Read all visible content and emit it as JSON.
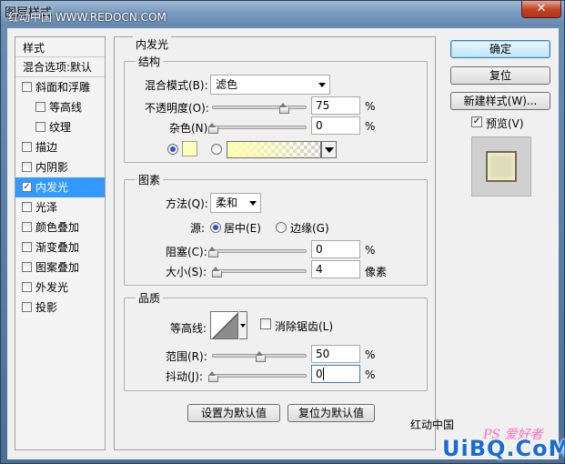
{
  "window": {
    "title": "图层样式",
    "watermark_top": "红动中国 WWW.REDOCN.COM",
    "close_label": "✕"
  },
  "style_list": {
    "header": "样式",
    "blend_options": "混合选项:默认",
    "items": [
      {
        "label": "斜面和浮雕",
        "checked": false,
        "indent": false,
        "active": false
      },
      {
        "label": "等高线",
        "checked": false,
        "indent": true,
        "active": false
      },
      {
        "label": "纹理",
        "checked": false,
        "indent": true,
        "active": false
      },
      {
        "label": "描边",
        "checked": false,
        "indent": false,
        "active": false
      },
      {
        "label": "内阴影",
        "checked": false,
        "indent": false,
        "active": false
      },
      {
        "label": "内发光",
        "checked": true,
        "indent": false,
        "active": true
      },
      {
        "label": "光泽",
        "checked": false,
        "indent": false,
        "active": false
      },
      {
        "label": "颜色叠加",
        "checked": false,
        "indent": false,
        "active": false
      },
      {
        "label": "渐变叠加",
        "checked": false,
        "indent": false,
        "active": false
      },
      {
        "label": "图案叠加",
        "checked": false,
        "indent": false,
        "active": false
      },
      {
        "label": "外发光",
        "checked": false,
        "indent": false,
        "active": false
      },
      {
        "label": "投影",
        "checked": false,
        "indent": false,
        "active": false
      }
    ]
  },
  "panel": {
    "title": "内发光",
    "structure": {
      "title": "结构",
      "blend_mode_label": "混合模式(B):",
      "blend_mode_value": "滤色",
      "opacity_label": "不透明度(O):",
      "opacity_value": "75",
      "opacity_level": 75,
      "opacity_unit": "%",
      "noise_label": "杂色(N):",
      "noise_value": "0",
      "noise_level": 0,
      "noise_unit": "%",
      "glow_color": "#ffffb9"
    },
    "elements": {
      "title": "图素",
      "technique_label": "方法(Q):",
      "technique_value": "柔和",
      "source_label": "源:",
      "source_center": "居中(E)",
      "source_edge": "边缘(G)",
      "choke_label": "阻塞(C):",
      "choke_value": "0",
      "choke_level": 0,
      "choke_unit": "%",
      "size_label": "大小(S):",
      "size_value": "4",
      "size_level": 4,
      "size_unit": "像素"
    },
    "quality": {
      "title": "品质",
      "contour_label": "等高线:",
      "antialias_label": "消除锯齿(L)",
      "range_label": "范围(R):",
      "range_value": "50",
      "range_level": 50,
      "range_unit": "%",
      "jitter_label": "抖动(J):",
      "jitter_value": "0",
      "jitter_level": 0,
      "jitter_unit": "%"
    },
    "make_default": "设置为默认值",
    "reset_default": "复位为默认值"
  },
  "right": {
    "ok": "确定",
    "reset": "复位",
    "new_style": "新建样式(W)...",
    "preview_label": "预览(V)"
  },
  "watermarks": {
    "bottom_text": "红动中国",
    "ps_mark": "PS 爱好者",
    "uibq": "UiBQ.CoM"
  }
}
